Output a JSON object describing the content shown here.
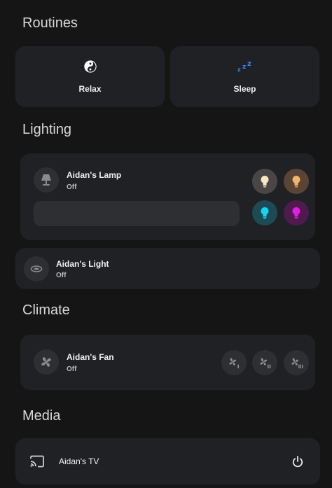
{
  "sections": {
    "routines": "Routines",
    "lighting": "Lighting",
    "climate": "Climate",
    "media": "Media"
  },
  "routines": [
    {
      "label": "Relax",
      "icon": "yin-yang-icon"
    },
    {
      "label": "Sleep",
      "icon": "sleep-zzz-icon",
      "icon_color": "#3b82f6"
    }
  ],
  "lamp": {
    "name": "Aidan's Lamp",
    "state": "Off",
    "icon": "lamp-icon",
    "brightness": 0,
    "color_presets": [
      {
        "name": "warm-white",
        "bg": "#4b4646",
        "bulb": "#f7e7c4"
      },
      {
        "name": "warm-orange",
        "bg": "#5a4434",
        "bulb": "#f4b36a"
      },
      {
        "name": "cyan",
        "bg": "#1d4a55",
        "bulb": "#19d4f0"
      },
      {
        "name": "magenta",
        "bg": "#4f1b4f",
        "bulb": "#e11ee1"
      }
    ]
  },
  "light": {
    "name": "Aidan's Light",
    "state": "Off",
    "icon": "ceiling-light-icon"
  },
  "fan": {
    "name": "Aidan's Fan",
    "state": "Off",
    "icon": "fan-icon",
    "speeds": [
      "fan-speed-1-icon",
      "fan-speed-2-icon",
      "fan-speed-3-icon"
    ]
  },
  "tv": {
    "name": "Aidan's TV",
    "icon": "cast-icon",
    "power_icon": "power-icon"
  },
  "colors": {
    "background": "#151515",
    "card": "#202124",
    "control": "#2e2f33",
    "sleep_accent": "#3b82f6"
  }
}
